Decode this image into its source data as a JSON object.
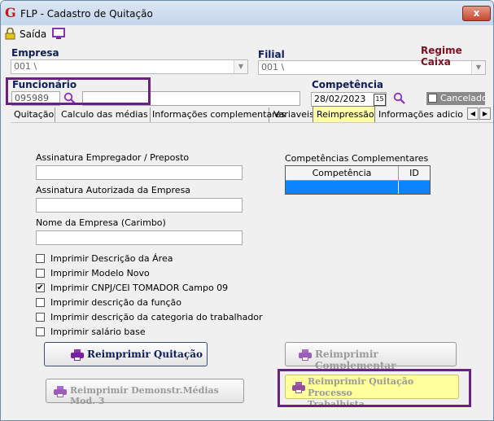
{
  "window": {
    "title": "FLP - Cadastro de Quitação",
    "close_label": "x",
    "logo_letter": "G"
  },
  "toolbar": {
    "exit_label": "Saída"
  },
  "empresa": {
    "label": "Empresa",
    "value": "001 \\"
  },
  "filial": {
    "label": "Filial",
    "value": "001 \\"
  },
  "regime": {
    "label": "Regime Caixa"
  },
  "funcionario": {
    "label": "Funcionário",
    "code": "095989",
    "name": ""
  },
  "competencia": {
    "label": "Competência",
    "value": "28/02/2023",
    "calendar_label": "15"
  },
  "cancelado": {
    "label": "Cancelado",
    "checked": false
  },
  "tabs": [
    {
      "label": "Quitação"
    },
    {
      "label": "Calculo das médias"
    },
    {
      "label": "Informações complementares"
    },
    {
      "label": "Variaveis"
    },
    {
      "label": "Reimpressão"
    },
    {
      "label": "Informações adicionais"
    }
  ],
  "form": {
    "assinatura_empregador_label": "Assinatura Empregador / Preposto",
    "assinatura_empresa_label": "Assinatura Autorizada da Empresa",
    "nome_empresa_label": "Nome da Empresa (Carimbo)",
    "assinatura_empregador_value": "",
    "assinatura_empresa_value": "",
    "nome_empresa_value": ""
  },
  "checkboxes": [
    {
      "label": "Imprimir Descrição da Área",
      "checked": false
    },
    {
      "label": "Imprimir Modelo Novo",
      "checked": false
    },
    {
      "label": "Imprimir CNPJ/CEI TOMADOR Campo 09",
      "checked": true
    },
    {
      "label": "Imprimir descrição da função",
      "checked": false
    },
    {
      "label": "Imprimir descrição da categoria do trabalhador",
      "checked": false
    },
    {
      "label": "Imprimir salário base",
      "checked": false
    }
  ],
  "competencias_complementares": {
    "title": "Competências Complementares",
    "columns": [
      "Competência",
      "ID"
    ]
  },
  "buttons": {
    "reimprimir_quitacao": "Reimprimir Quitação",
    "reimprimir_complementar": "Reimprimir Complementar",
    "reimprimir_demonstr": "Reimprimir Demonstr.Médias Mod. 3",
    "reimprimir_processo_line1": "Reimprimir Quitação Processo",
    "reimprimir_processo_line2": "Trabalhista"
  },
  "colors": {
    "accent_purple": "#6b2182",
    "tab_active_bg": "#ffffa8",
    "grid_selected": "#0a84ff",
    "label_blue": "#0c1d5a",
    "regime_red": "#7a0f1f"
  }
}
